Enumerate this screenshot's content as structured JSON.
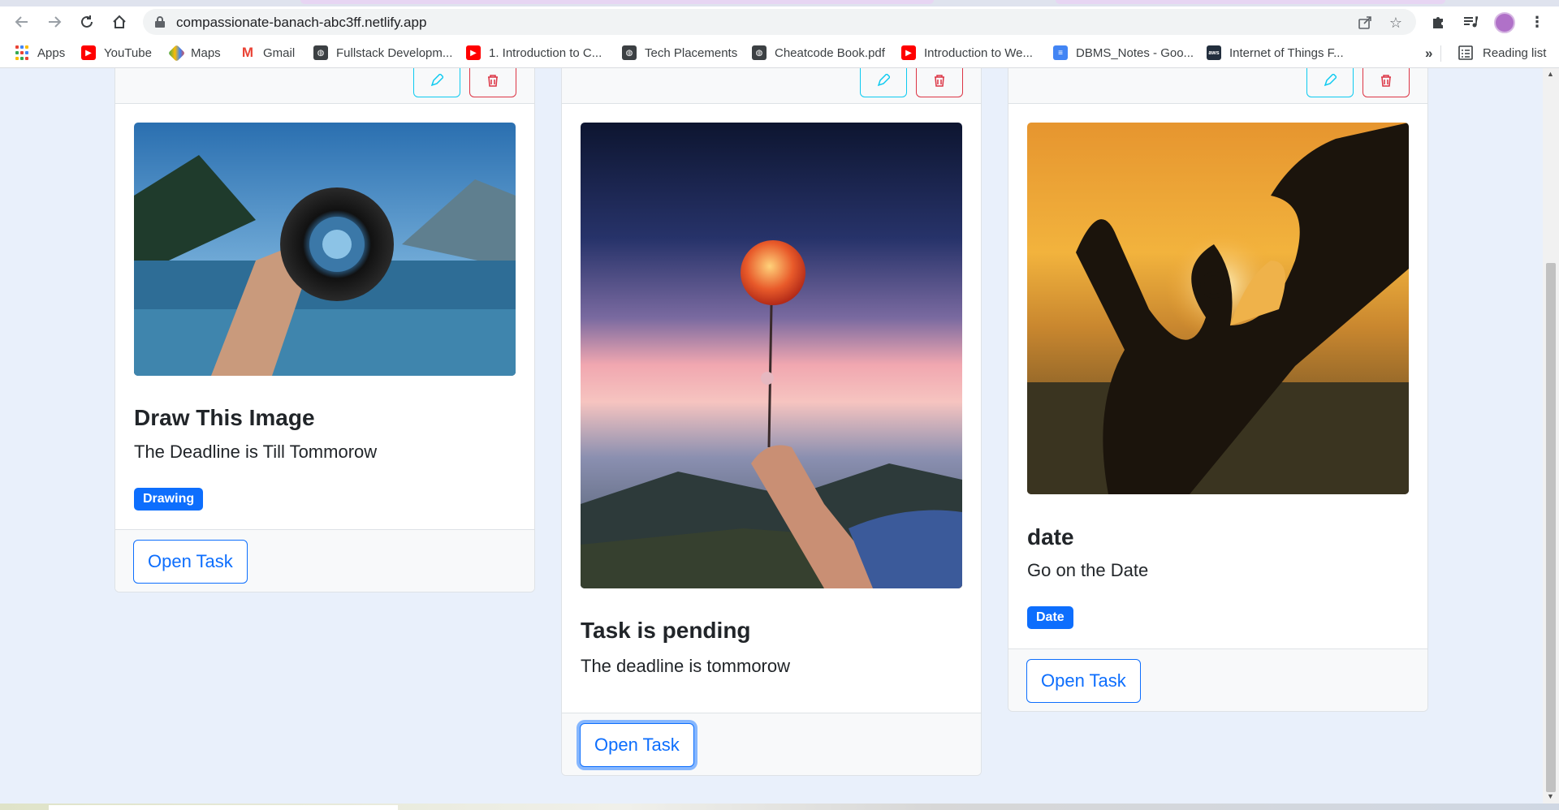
{
  "browser": {
    "url": "compassionate-banach-abc3ff.netlify.app",
    "bookmarks": [
      {
        "label": "Apps",
        "icon": "apps-grid-icon"
      },
      {
        "label": "YouTube",
        "icon": "youtube-icon"
      },
      {
        "label": "Maps",
        "icon": "maps-icon"
      },
      {
        "label": "Gmail",
        "icon": "gmail-icon"
      },
      {
        "label": "Fullstack Developm...",
        "icon": "globe-icon"
      },
      {
        "label": "1. Introduction to C...",
        "icon": "youtube-icon"
      },
      {
        "label": "Tech Placements",
        "icon": "globe-icon"
      },
      {
        "label": "Cheatcode Book.pdf",
        "icon": "globe-icon"
      },
      {
        "label": "Introduction to We...",
        "icon": "youtube-icon"
      },
      {
        "label": "DBMS_Notes - Goo...",
        "icon": "google-docs-icon"
      },
      {
        "label": "Internet of Things F...",
        "icon": "aws-icon"
      }
    ],
    "more_bookmarks": "»",
    "reading_list": "Reading list",
    "aws_text": "aws",
    "colors": {
      "youtube": "#ff0000",
      "docs": "#4285f4"
    }
  },
  "tasks": [
    {
      "title": "Draw This Image",
      "description": "The Deadline is Till Tommorow",
      "badge": "Drawing",
      "button": "Open Task"
    },
    {
      "title": "Task is pending",
      "description": "The deadline is tommorow",
      "badge": "",
      "button": "Open Task"
    },
    {
      "title": "date",
      "description": "Go on the Date",
      "badge": "Date",
      "button": "Open Task"
    }
  ],
  "theme": {
    "primary": "#0d6efd",
    "info": "#0dcaf0",
    "danger": "#dc3545",
    "page_bg": "#e9f0fb"
  }
}
